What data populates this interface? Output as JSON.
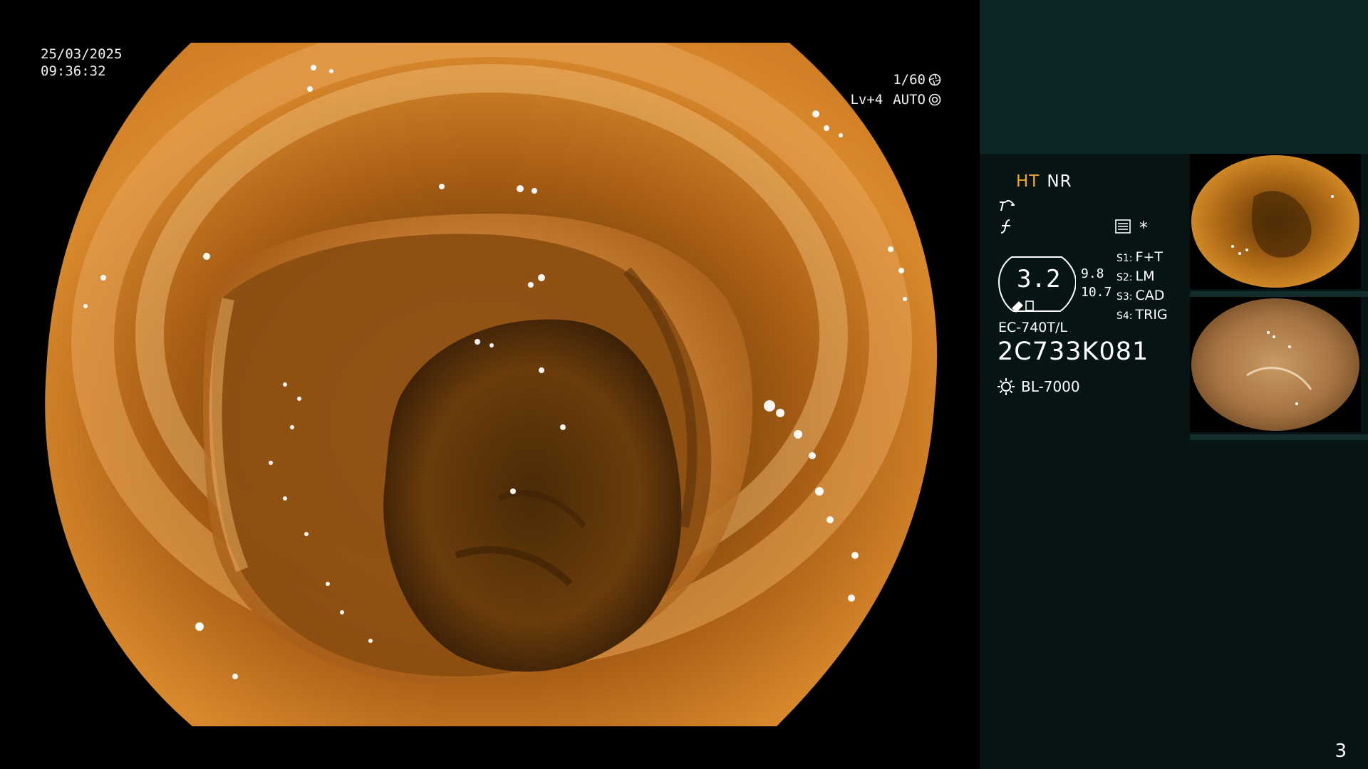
{
  "overlay": {
    "date": "25/03/2025",
    "time": "09:36:32",
    "shutter": "1/60",
    "level": "Lv+4",
    "iris": "AUTO"
  },
  "panel": {
    "mode_ht": "HT",
    "mode_nr": "NR",
    "settings_indicator": "*",
    "zoom_value": "3.2",
    "value_a": "9.8",
    "value_b": "10.7",
    "switches": [
      {
        "key": "S1:",
        "value": "F+T"
      },
      {
        "key": "S2:",
        "value": "LM"
      },
      {
        "key": "S3:",
        "value": "CAD"
      },
      {
        "key": "S4:",
        "value": "TRIG"
      }
    ],
    "scope_model": "EC-740T/L",
    "serial": "2C733K081",
    "light_source": "BL-7000",
    "page_number": "3"
  },
  "colors": {
    "ht_accent": "#f4a62a",
    "panel_bg": "#061414",
    "panel_top": "#0d2625"
  },
  "icons": {
    "shutter": "aperture-icon",
    "iris": "iris-icon",
    "structure": "structure-enhance-icon",
    "color": "color-enhance-icon",
    "settings": "settings-list-icon",
    "light": "light-source-icon"
  }
}
